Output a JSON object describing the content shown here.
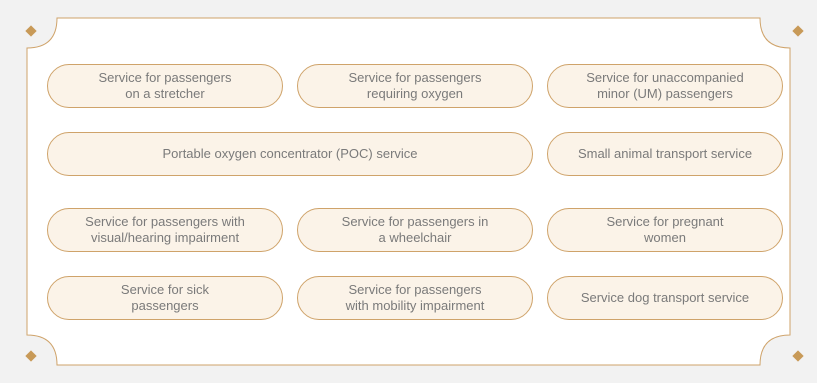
{
  "colors": {
    "page_background": "#f2f2f2",
    "panel_background": "#ffffff",
    "accent_border": "#cfa36a",
    "pill_fill": "#fbf3e8",
    "text": "#7a7a7a",
    "ornament": "#c89a58"
  },
  "services": [
    {
      "label_line1": "Service for passengers",
      "label_line2": "on a stretcher"
    },
    {
      "label_line1": "Service for passengers",
      "label_line2": "requiring oxygen"
    },
    {
      "label_line1": "Service for unaccompanied",
      "label_line2": "minor (UM) passengers"
    },
    {
      "label_line1": "Portable oxygen concentrator (POC) service",
      "label_line2": ""
    },
    {
      "label_line1": "Small animal transport service",
      "label_line2": ""
    },
    {
      "label_line1": "Service for passengers with",
      "label_line2": "visual/hearing impairment"
    },
    {
      "label_line1": "Service for passengers in",
      "label_line2": "a wheelchair"
    },
    {
      "label_line1": "Service for pregnant",
      "label_line2": "women"
    },
    {
      "label_line1": "Service for sick",
      "label_line2": "passengers"
    },
    {
      "label_line1": "Service for passengers",
      "label_line2": "with mobility impairment"
    },
    {
      "label_line1": "Service dog transport service",
      "label_line2": ""
    }
  ]
}
